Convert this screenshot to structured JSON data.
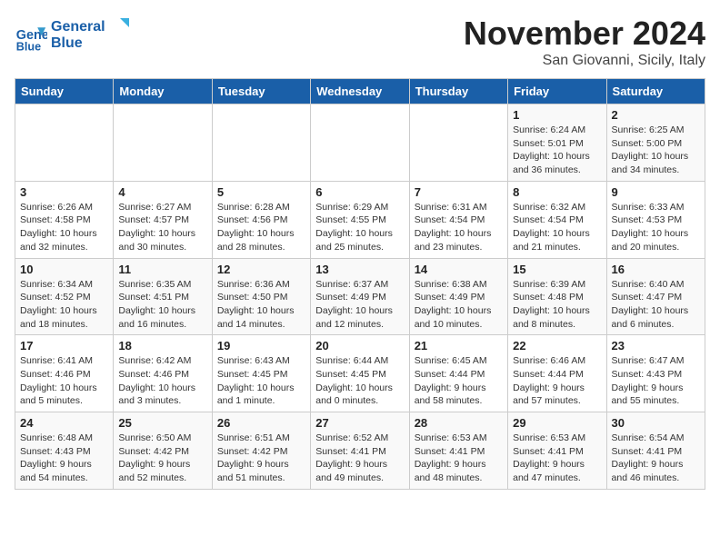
{
  "header": {
    "logo_line1": "General",
    "logo_line2": "Blue",
    "month": "November 2024",
    "location": "San Giovanni, Sicily, Italy"
  },
  "days_of_week": [
    "Sunday",
    "Monday",
    "Tuesday",
    "Wednesday",
    "Thursday",
    "Friday",
    "Saturday"
  ],
  "weeks": [
    [
      {
        "day": "",
        "info": ""
      },
      {
        "day": "",
        "info": ""
      },
      {
        "day": "",
        "info": ""
      },
      {
        "day": "",
        "info": ""
      },
      {
        "day": "",
        "info": ""
      },
      {
        "day": "1",
        "info": "Sunrise: 6:24 AM\nSunset: 5:01 PM\nDaylight: 10 hours\nand 36 minutes."
      },
      {
        "day": "2",
        "info": "Sunrise: 6:25 AM\nSunset: 5:00 PM\nDaylight: 10 hours\nand 34 minutes."
      }
    ],
    [
      {
        "day": "3",
        "info": "Sunrise: 6:26 AM\nSunset: 4:58 PM\nDaylight: 10 hours\nand 32 minutes."
      },
      {
        "day": "4",
        "info": "Sunrise: 6:27 AM\nSunset: 4:57 PM\nDaylight: 10 hours\nand 30 minutes."
      },
      {
        "day": "5",
        "info": "Sunrise: 6:28 AM\nSunset: 4:56 PM\nDaylight: 10 hours\nand 28 minutes."
      },
      {
        "day": "6",
        "info": "Sunrise: 6:29 AM\nSunset: 4:55 PM\nDaylight: 10 hours\nand 25 minutes."
      },
      {
        "day": "7",
        "info": "Sunrise: 6:31 AM\nSunset: 4:54 PM\nDaylight: 10 hours\nand 23 minutes."
      },
      {
        "day": "8",
        "info": "Sunrise: 6:32 AM\nSunset: 4:54 PM\nDaylight: 10 hours\nand 21 minutes."
      },
      {
        "day": "9",
        "info": "Sunrise: 6:33 AM\nSunset: 4:53 PM\nDaylight: 10 hours\nand 20 minutes."
      }
    ],
    [
      {
        "day": "10",
        "info": "Sunrise: 6:34 AM\nSunset: 4:52 PM\nDaylight: 10 hours\nand 18 minutes."
      },
      {
        "day": "11",
        "info": "Sunrise: 6:35 AM\nSunset: 4:51 PM\nDaylight: 10 hours\nand 16 minutes."
      },
      {
        "day": "12",
        "info": "Sunrise: 6:36 AM\nSunset: 4:50 PM\nDaylight: 10 hours\nand 14 minutes."
      },
      {
        "day": "13",
        "info": "Sunrise: 6:37 AM\nSunset: 4:49 PM\nDaylight: 10 hours\nand 12 minutes."
      },
      {
        "day": "14",
        "info": "Sunrise: 6:38 AM\nSunset: 4:49 PM\nDaylight: 10 hours\nand 10 minutes."
      },
      {
        "day": "15",
        "info": "Sunrise: 6:39 AM\nSunset: 4:48 PM\nDaylight: 10 hours\nand 8 minutes."
      },
      {
        "day": "16",
        "info": "Sunrise: 6:40 AM\nSunset: 4:47 PM\nDaylight: 10 hours\nand 6 minutes."
      }
    ],
    [
      {
        "day": "17",
        "info": "Sunrise: 6:41 AM\nSunset: 4:46 PM\nDaylight: 10 hours\nand 5 minutes."
      },
      {
        "day": "18",
        "info": "Sunrise: 6:42 AM\nSunset: 4:46 PM\nDaylight: 10 hours\nand 3 minutes."
      },
      {
        "day": "19",
        "info": "Sunrise: 6:43 AM\nSunset: 4:45 PM\nDaylight: 10 hours\nand 1 minute."
      },
      {
        "day": "20",
        "info": "Sunrise: 6:44 AM\nSunset: 4:45 PM\nDaylight: 10 hours\nand 0 minutes."
      },
      {
        "day": "21",
        "info": "Sunrise: 6:45 AM\nSunset: 4:44 PM\nDaylight: 9 hours\nand 58 minutes."
      },
      {
        "day": "22",
        "info": "Sunrise: 6:46 AM\nSunset: 4:44 PM\nDaylight: 9 hours\nand 57 minutes."
      },
      {
        "day": "23",
        "info": "Sunrise: 6:47 AM\nSunset: 4:43 PM\nDaylight: 9 hours\nand 55 minutes."
      }
    ],
    [
      {
        "day": "24",
        "info": "Sunrise: 6:48 AM\nSunset: 4:43 PM\nDaylight: 9 hours\nand 54 minutes."
      },
      {
        "day": "25",
        "info": "Sunrise: 6:50 AM\nSunset: 4:42 PM\nDaylight: 9 hours\nand 52 minutes."
      },
      {
        "day": "26",
        "info": "Sunrise: 6:51 AM\nSunset: 4:42 PM\nDaylight: 9 hours\nand 51 minutes."
      },
      {
        "day": "27",
        "info": "Sunrise: 6:52 AM\nSunset: 4:41 PM\nDaylight: 9 hours\nand 49 minutes."
      },
      {
        "day": "28",
        "info": "Sunrise: 6:53 AM\nSunset: 4:41 PM\nDaylight: 9 hours\nand 48 minutes."
      },
      {
        "day": "29",
        "info": "Sunrise: 6:53 AM\nSunset: 4:41 PM\nDaylight: 9 hours\nand 47 minutes."
      },
      {
        "day": "30",
        "info": "Sunrise: 6:54 AM\nSunset: 4:41 PM\nDaylight: 9 hours\nand 46 minutes."
      }
    ]
  ]
}
